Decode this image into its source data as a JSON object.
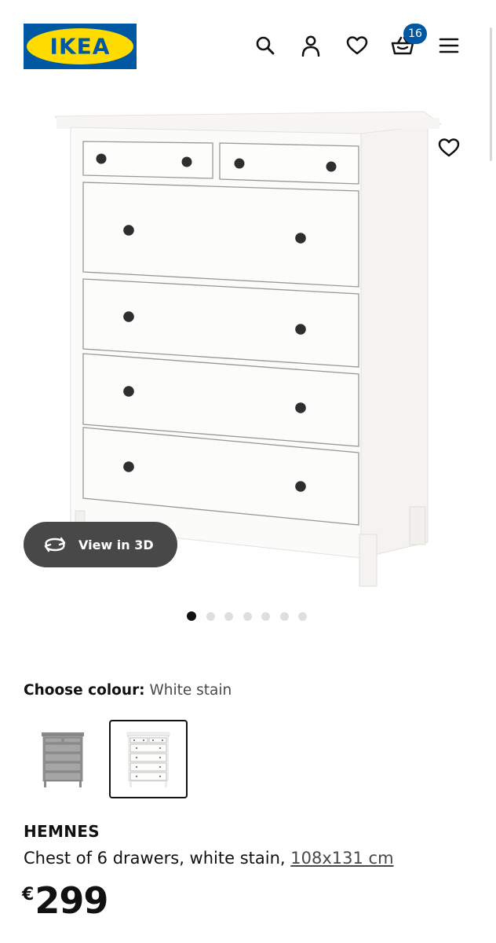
{
  "header": {
    "logo_text": "IKEA",
    "cart_count": "16",
    "icons": [
      "search-icon",
      "user-icon",
      "heart-icon",
      "basket-icon",
      "menu-icon"
    ]
  },
  "gallery": {
    "view_3d_label": "View in 3D",
    "total_images": 7,
    "active_index": 0
  },
  "colour": {
    "label": "Choose colour:",
    "value": "White stain",
    "options": [
      "grey stain",
      "white stain"
    ],
    "selected_index": 1
  },
  "product": {
    "name": "HEMNES",
    "description": "Chest of 6 drawers, white stain, ",
    "size": "108x131 cm",
    "price_currency": "€",
    "price_amount": "299"
  },
  "colors": {
    "brand_blue": "#0058a3",
    "brand_yellow": "#ffdb00",
    "button_dark": "#484848"
  }
}
